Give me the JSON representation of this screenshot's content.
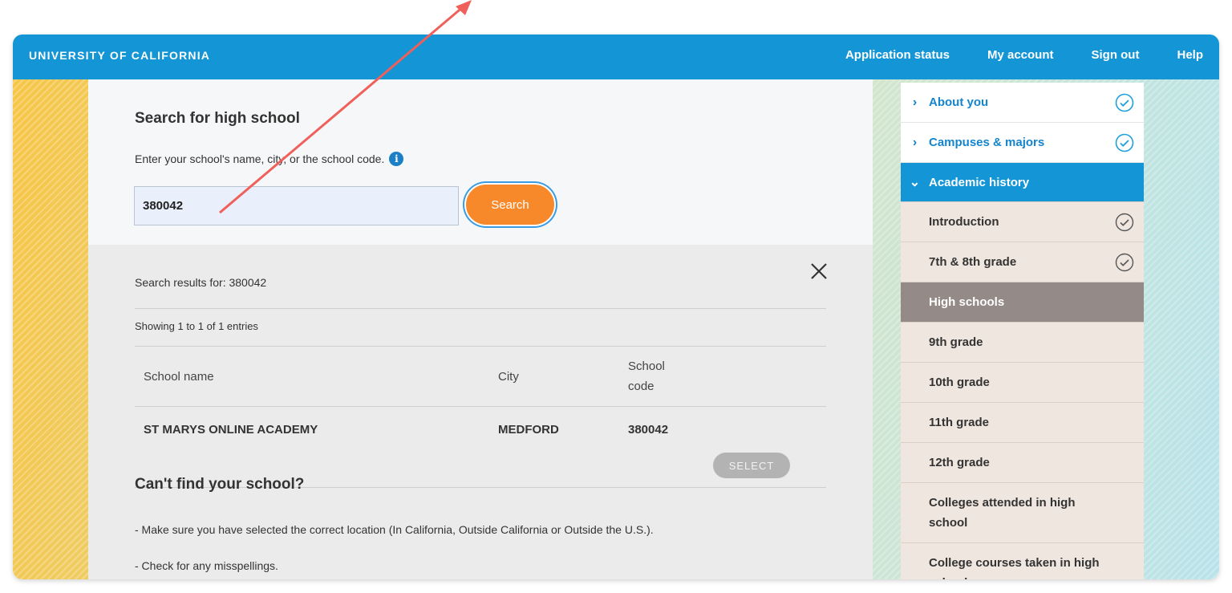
{
  "header": {
    "brand": "UNIVERSITY OF CALIFORNIA",
    "nav": [
      "Application status",
      "My account",
      "Sign out",
      "Help"
    ]
  },
  "search": {
    "title": "Search for high school",
    "hint": "Enter your school's name, city, or the school code.",
    "input_value": "380042",
    "button_label": "Search"
  },
  "results": {
    "results_for": "Search results for: 380042",
    "showing": "Showing 1 to 1 of 1 entries",
    "columns": {
      "name": "School name",
      "city": "City",
      "code_line1": "School",
      "code_line2": "code"
    },
    "rows": [
      {
        "name": "ST MARYS ONLINE ACADEMY",
        "city": "MEDFORD",
        "code": "380042",
        "action": "SELECT"
      }
    ]
  },
  "help": {
    "title": "Can't find your school?",
    "tips": [
      "- Make sure you have selected the correct location (In California, Outside California or Outside the U.S.).",
      "- Check for any misspellings."
    ]
  },
  "sidebar": {
    "items": [
      {
        "label": "About you",
        "state": "done"
      },
      {
        "label": "Campuses & majors",
        "state": "done"
      },
      {
        "label": "Academic history",
        "state": "expanded"
      },
      {
        "label": "Introduction",
        "state": "done"
      },
      {
        "label": "7th & 8th grade",
        "state": "done"
      },
      {
        "label": "High schools",
        "state": "current"
      },
      {
        "label": "9th grade",
        "state": "todo"
      },
      {
        "label": "10th grade",
        "state": "todo"
      },
      {
        "label": "11th grade",
        "state": "todo"
      },
      {
        "label": "12th grade",
        "state": "todo"
      },
      {
        "label_line1": "Colleges attended in high",
        "label_line2": "school",
        "state": "todo"
      },
      {
        "label_line1": "College courses taken in high",
        "label_line2": "school",
        "state": "todo"
      }
    ]
  },
  "colors": {
    "brand_blue": "#1395d6",
    "accent_orange": "#f7892a",
    "annotation_red": "#f0605a"
  }
}
